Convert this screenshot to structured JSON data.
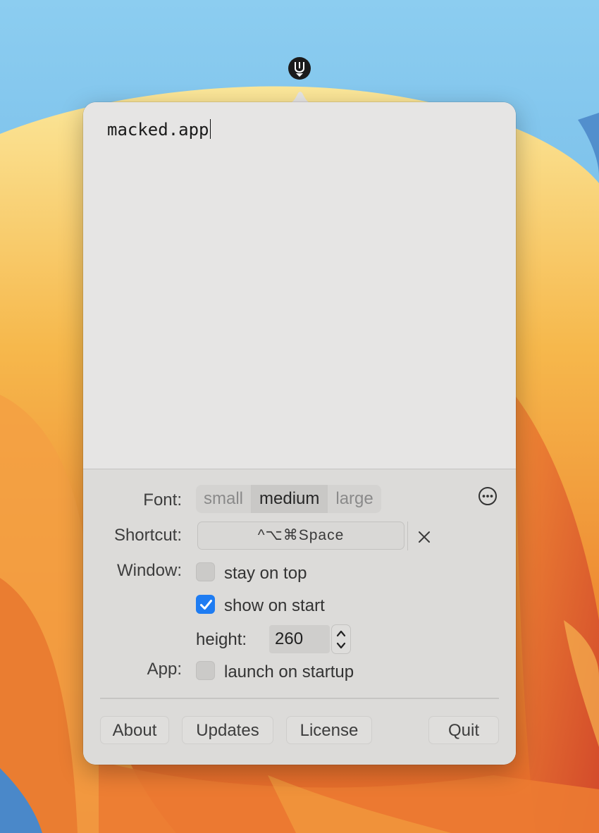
{
  "editor": {
    "text": "macked.app"
  },
  "settings": {
    "font": {
      "label": "Font:",
      "options": [
        "small",
        "medium",
        "large"
      ],
      "selected": "medium"
    },
    "more_icon": "ellipsis-circle-icon",
    "shortcut": {
      "label": "Shortcut:",
      "value": "^⌥⌘Space",
      "clear_icon": "close-icon"
    },
    "window": {
      "label": "Window:",
      "stay_on_top": {
        "label": "stay on top",
        "checked": false
      },
      "show_on_start": {
        "label": "show on start",
        "checked": true
      },
      "height_label": "height:",
      "height_value": "260"
    },
    "app": {
      "label": "App:",
      "launch_on_startup": {
        "label": "launch on startup",
        "checked": false
      }
    }
  },
  "footer": {
    "about": "About",
    "updates": "Updates",
    "license": "License",
    "quit": "Quit"
  },
  "colors": {
    "accent": "#1e7cf2",
    "popover_bg": "#e6e5e4",
    "prefs_bg": "#dcdbd9"
  }
}
